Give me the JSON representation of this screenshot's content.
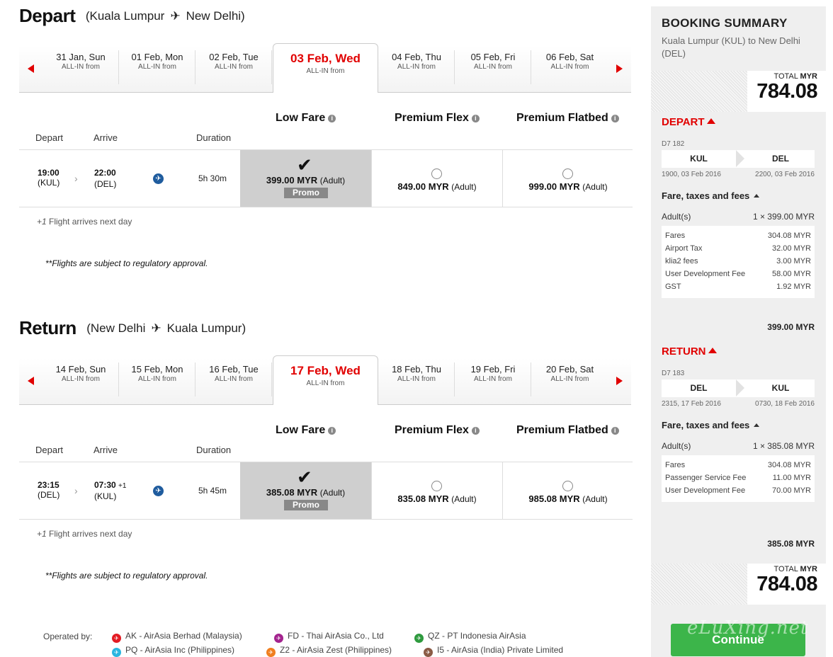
{
  "depart": {
    "title": "Depart",
    "route_from": "(Kuala Lumpur",
    "route_to": "New Delhi)",
    "dates": [
      {
        "day": "31 Jan, Sun",
        "sub": "ALL-IN from"
      },
      {
        "day": "01 Feb, Mon",
        "sub": "ALL-IN from"
      },
      {
        "day": "02 Feb, Tue",
        "sub": "ALL-IN from"
      },
      {
        "day": "03 Feb, Wed",
        "sub": "ALL-IN from"
      },
      {
        "day": "04 Feb, Thu",
        "sub": "ALL-IN from"
      },
      {
        "day": "05 Feb, Fri",
        "sub": "ALL-IN from"
      },
      {
        "day": "06 Feb, Sat",
        "sub": "ALL-IN from"
      }
    ],
    "fare_headers": {
      "low": "Low Fare",
      "flex": "Premium Flex",
      "flat": "Premium Flatbed"
    },
    "col_labels": {
      "depart": "Depart",
      "arrive": "Arrive",
      "duration": "Duration"
    },
    "flight": {
      "dep_time": "19:00",
      "dep_code": "(KUL)",
      "arr_time": "22:00",
      "arr_plus": "",
      "arr_code": "(DEL)",
      "duration": "5h 30m",
      "low_price": "399.00 MYR",
      "flex_price": "849.00 MYR",
      "flat_price": "999.00 MYR",
      "adult": "(Adult)",
      "promo": "Promo"
    },
    "note_plus": "+1",
    "note_next": " Flight arrives next day",
    "note_reg": "**Flights are subject to regulatory approval."
  },
  "return": {
    "title": "Return",
    "route_from": "(New Delhi",
    "route_to": "Kuala Lumpur)",
    "dates": [
      {
        "day": "14 Feb, Sun",
        "sub": "ALL-IN from"
      },
      {
        "day": "15 Feb, Mon",
        "sub": "ALL-IN from"
      },
      {
        "day": "16 Feb, Tue",
        "sub": "ALL-IN from"
      },
      {
        "day": "17 Feb, Wed",
        "sub": "ALL-IN from"
      },
      {
        "day": "18 Feb, Thu",
        "sub": "ALL-IN from"
      },
      {
        "day": "19 Feb, Fri",
        "sub": "ALL-IN from"
      },
      {
        "day": "20 Feb, Sat",
        "sub": "ALL-IN from"
      }
    ],
    "fare_headers": {
      "low": "Low Fare",
      "flex": "Premium Flex",
      "flat": "Premium Flatbed"
    },
    "col_labels": {
      "depart": "Depart",
      "arrive": "Arrive",
      "duration": "Duration"
    },
    "flight": {
      "dep_time": "23:15",
      "dep_code": "(DEL)",
      "arr_time": "07:30",
      "arr_plus": "+1",
      "arr_code": "(KUL)",
      "duration": "5h 45m",
      "low_price": "385.08 MYR",
      "flex_price": "835.08 MYR",
      "flat_price": "985.08 MYR",
      "adult": "(Adult)",
      "promo": "Promo"
    },
    "note_plus": "+1",
    "note_next": " Flight arrives next day",
    "note_reg": "**Flights are subject to regulatory approval."
  },
  "operated": {
    "label": "Operated by:",
    "carriers": [
      {
        "text": "AK - AirAsia Berhad (Malaysia)",
        "color": "#e31b23"
      },
      {
        "text": "FD - Thai AirAsia Co., Ltd",
        "color": "#a3238e"
      },
      {
        "text": "QZ - PT Indonesia AirAsia",
        "color": "#2e9a3e"
      },
      {
        "text": "PQ - AirAsia Inc (Philippines)",
        "color": "#29b6e0"
      },
      {
        "text": "Z2 - AirAsia Zest (Philippines)",
        "color": "#f07f1f"
      },
      {
        "text": "I5 - AirAsia (India) Private Limited",
        "color": "#8a5a44"
      }
    ]
  },
  "summary": {
    "title": "BOOKING SUMMARY",
    "route": "Kuala Lumpur (KUL) to New Delhi (DEL)",
    "total_label": "TOTAL",
    "total_currency": "MYR",
    "total_value": "784.08",
    "depart": {
      "heading": "DEPART",
      "flight_no": "D7 182",
      "from": "KUL",
      "to": "DEL",
      "from_dt": "1900, 03 Feb 2016",
      "to_dt": "2200, 03 Feb 2016",
      "fth": "Fare, taxes and fees",
      "adult_label": "Adult(s)",
      "adult_value": "1 × 399.00 MYR",
      "breakdown": [
        {
          "label": "Fares",
          "value": "304.08 MYR"
        },
        {
          "label": "Airport Tax",
          "value": "32.00 MYR"
        },
        {
          "label": "klia2 fees",
          "value": "3.00 MYR"
        },
        {
          "label": "User Development Fee",
          "value": "58.00 MYR"
        },
        {
          "label": "GST",
          "value": "1.92 MYR"
        }
      ],
      "subtotal": "399.00 MYR"
    },
    "return": {
      "heading": "RETURN",
      "flight_no": "D7 183",
      "from": "DEL",
      "to": "KUL",
      "from_dt": "2315, 17 Feb 2016",
      "to_dt": "0730, 18 Feb 2016",
      "fth": "Fare, taxes and fees",
      "adult_label": "Adult(s)",
      "adult_value": "1 × 385.08 MYR",
      "breakdown": [
        {
          "label": "Fares",
          "value": "304.08 MYR"
        },
        {
          "label": "Passenger Service Fee",
          "value": "11.00 MYR"
        },
        {
          "label": "User Development Fee",
          "value": "70.00 MYR"
        }
      ],
      "subtotal": "385.08 MYR"
    }
  },
  "continue_label": "Continue",
  "watermark": "eLuXing.net"
}
